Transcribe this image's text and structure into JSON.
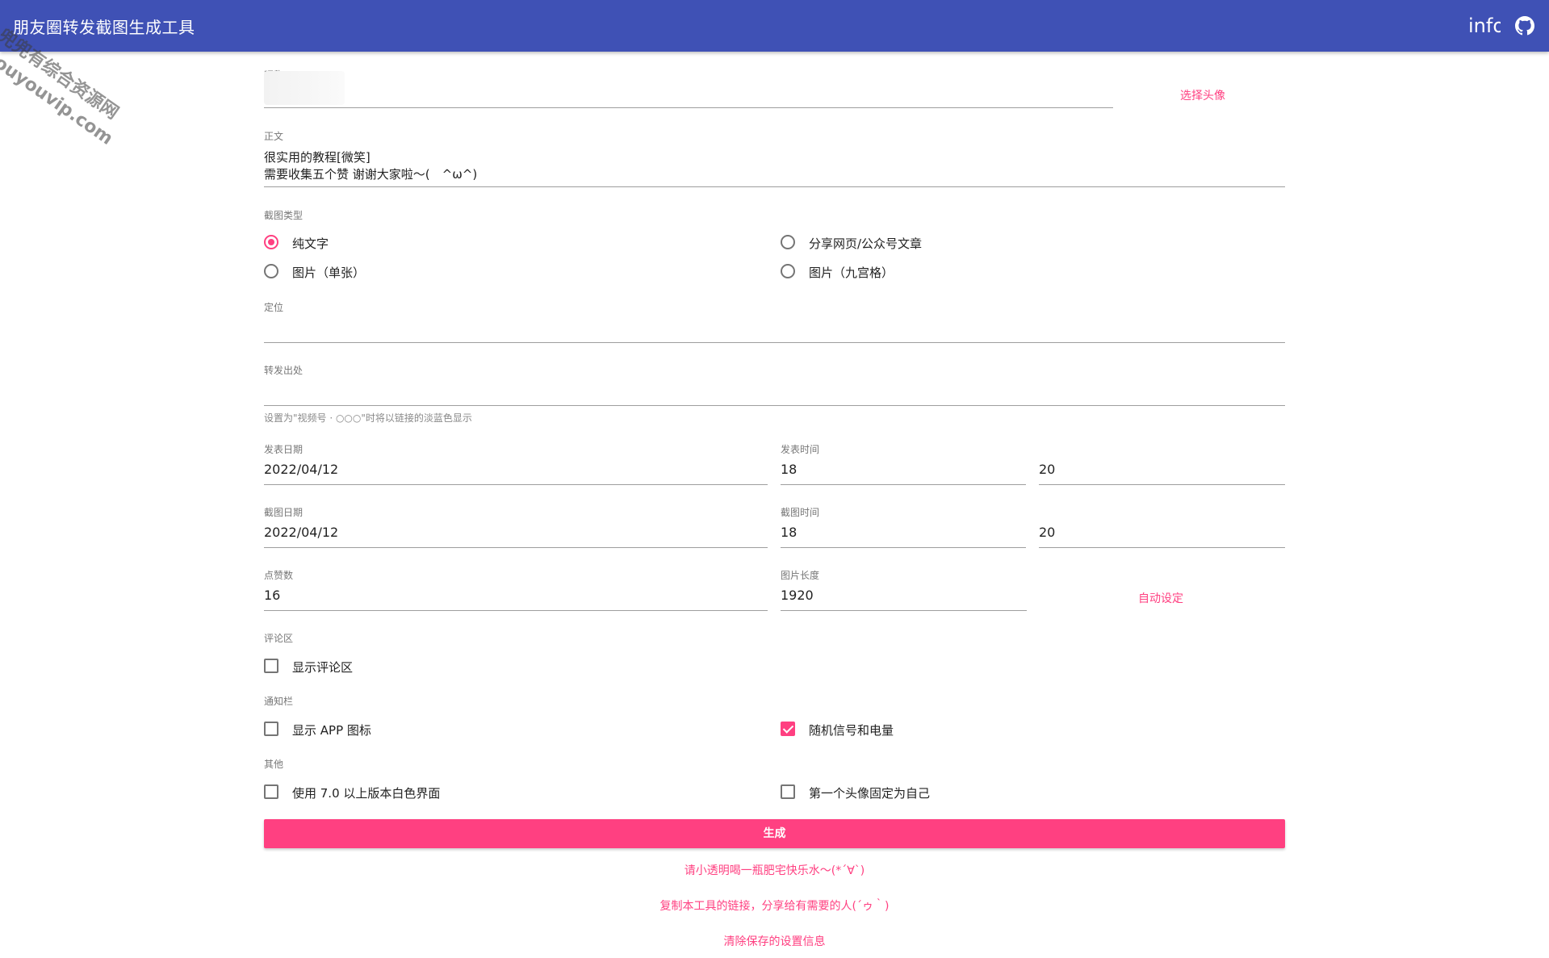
{
  "appbar": {
    "title": "朋友圈转发截图生成工具",
    "info_label": "info",
    "github_icon": "github-icon",
    "color": "#3f51b5"
  },
  "watermark": {
    "line1": "兜兜有综合资源网",
    "line2": "douyouvip.com"
  },
  "form": {
    "nickname": {
      "label": "昵称",
      "value": ""
    },
    "choose_avatar": "选择头像",
    "body": {
      "label": "正文",
      "line1": "很实用的教程[微笑]",
      "line2": "需要收集五个赞 谢谢大家啦～(　^ω^)"
    },
    "screenshot_type": {
      "label": "截图类型",
      "options": [
        {
          "label": "纯文字",
          "checked": true
        },
        {
          "label": "分享网页/公众号文章",
          "checked": false
        },
        {
          "label": "图片（单张）",
          "checked": false
        },
        {
          "label": "图片（九宫格）",
          "checked": false
        }
      ]
    },
    "location": {
      "label": "定位",
      "value": ""
    },
    "source": {
      "label": "转发出处",
      "value": "",
      "helper": "设置为\"视频号 · ○○○\"时将以链接的淡蓝色显示"
    },
    "publish_date": {
      "label": "发表日期",
      "value": "2022/04/12"
    },
    "publish_time": {
      "label": "发表时间",
      "hour": "18",
      "minute": "20"
    },
    "capture_date": {
      "label": "截图日期",
      "value": "2022/04/12"
    },
    "capture_time": {
      "label": "截图时间",
      "hour": "18",
      "minute": "20"
    },
    "likes": {
      "label": "点赞数",
      "value": "16"
    },
    "image_length": {
      "label": "图片长度",
      "value": "1920"
    },
    "auto_set": "自动设定",
    "comments": {
      "label": "评论区",
      "show_comments": {
        "label": "显示评论区",
        "checked": false
      }
    },
    "status_bar": {
      "label": "通知栏",
      "show_app_icon": {
        "label": "显示 APP 图标",
        "checked": false
      },
      "random_signal": {
        "label": "随机信号和电量",
        "checked": true
      }
    },
    "other": {
      "label": "其他",
      "white_ui": {
        "label": "使用 7.0 以上版本白色界面",
        "checked": false
      },
      "first_avatar_self": {
        "label": "第一个头像固定为自己",
        "checked": false
      }
    },
    "generate_button": "生成"
  },
  "footer": {
    "link1": "请小透明喝一瓶肥宅快乐水～(*´∀`)",
    "link2": "复制本工具的链接，分享给有需要的人(´ゥ｀)",
    "link3": "清除保存的设置信息"
  },
  "colors": {
    "accent": "#ff4081",
    "primary": "#3f51b5"
  }
}
